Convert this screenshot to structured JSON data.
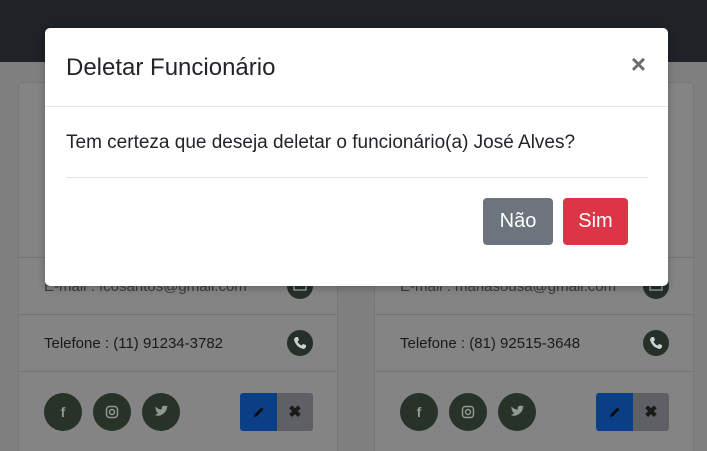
{
  "modal": {
    "title": "Deletar Funcionário",
    "close_icon": "×",
    "message": "Tem certeza que deseja deletar o funcionário(a) José Alves?",
    "no_label": "Não",
    "yes_label": "Sim"
  },
  "cards": [
    {
      "email_text": "E-mail : fcosantos@gmail.com",
      "phone_text": "Telefone : (11) 91234-3782"
    },
    {
      "email_text": "E-mail : mariasousa@gmail.com",
      "phone_text": "Telefone : (81) 92515-3648"
    }
  ],
  "social_icons": [
    "facebook-icon",
    "instagram-icon",
    "twitter-icon"
  ],
  "colors": {
    "danger": "#dc3545",
    "secondary": "#6c757d",
    "primary": "#0a3f86"
  }
}
